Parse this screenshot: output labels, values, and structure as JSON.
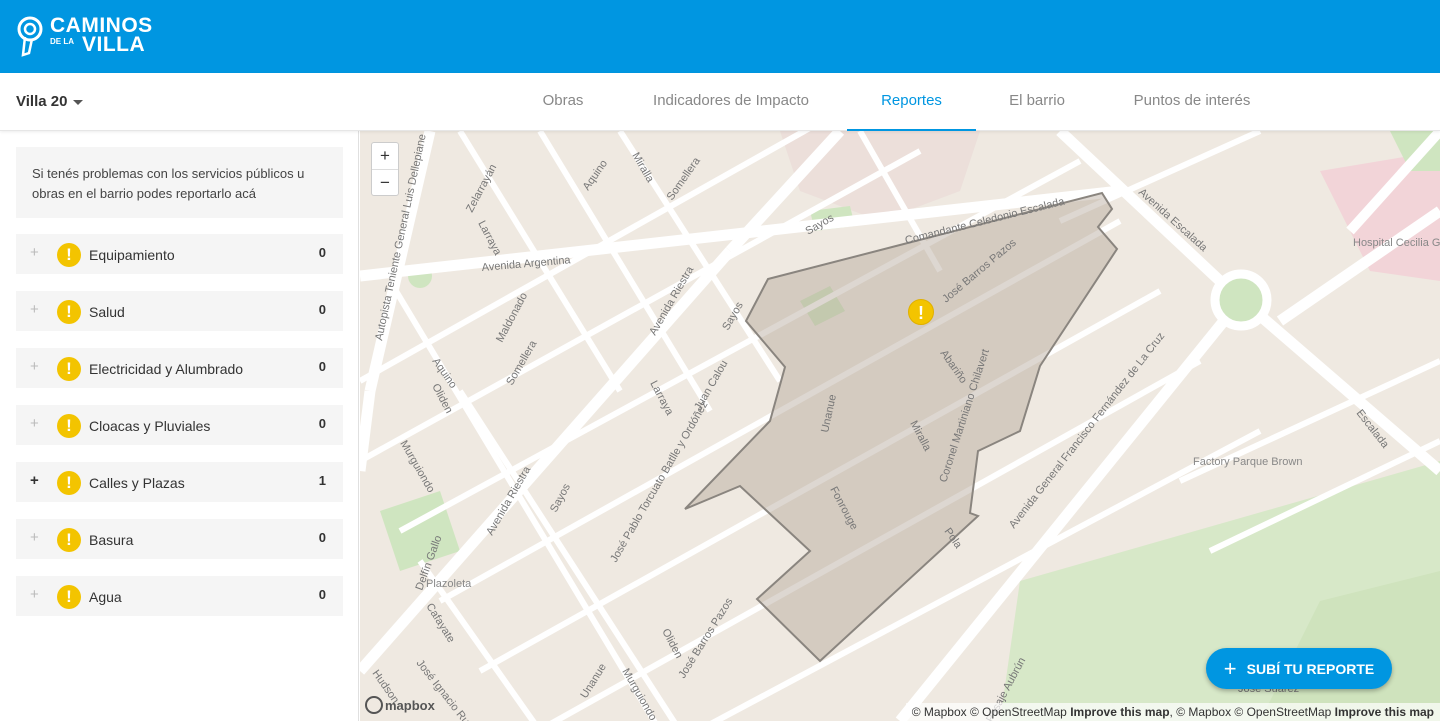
{
  "header": {
    "logo_line1": "CAMINOS",
    "logo_line2": "DE LA",
    "logo_line3": "VILLA",
    "bg_color": "#0096e1"
  },
  "villa_selector": {
    "label": "Villa 20"
  },
  "tabs": [
    {
      "label": "Obras",
      "active": false
    },
    {
      "label": "Indicadores de Impacto",
      "active": false
    },
    {
      "label": "Reportes",
      "active": true
    },
    {
      "label": "El barrio",
      "active": false
    },
    {
      "label": "Puntos de interés",
      "active": false
    }
  ],
  "sidebar": {
    "intro": "Si tenés problemas con los servicios públicos u obras en el barrio podes reportarlo acá",
    "categories": [
      {
        "name": "Equipamiento",
        "count": "0",
        "expand": "+"
      },
      {
        "name": "Salud",
        "count": "0",
        "expand": "+"
      },
      {
        "name": "Electricidad y Alumbrado",
        "count": "0",
        "expand": "+"
      },
      {
        "name": "Cloacas y Pluviales",
        "count": "0",
        "expand": "+"
      },
      {
        "name": "Calles y Plazas",
        "count": "1",
        "expand": "+"
      },
      {
        "name": "Basura",
        "count": "0",
        "expand": "+"
      },
      {
        "name": "Agua",
        "count": "0",
        "expand": "+"
      }
    ],
    "warning_glyph": "!"
  },
  "map": {
    "zoom_in": "+",
    "zoom_out": "−",
    "pin_glyph": "!",
    "mapbox_logo": "mapbox",
    "attribution_parts": [
      "© Mapbox © OpenStreetMap ",
      "Improve this map",
      ", © Mapbox © OpenStreetMap ",
      "Improve this map"
    ],
    "fab_plus": "+",
    "fab_label": "SUBÍ TU REPORTE",
    "street_labels": {
      "autopista": "Autopista Teniente General Luis Dellepiane",
      "zelarrayan": "Zelarrayán",
      "larraya": "Larraya",
      "aquino": "Aquino",
      "miralla": "Miralla",
      "somellera": "Somellera",
      "sayos": "Sayos",
      "celedonio": "Comandante Celedonio Escalada",
      "av_argentina": "Avenida Argentina",
      "maldonado": "Maldonado",
      "av_riestra": "Avenida Riestra",
      "oliden": "Oliden",
      "murguiondo": "Murguiondo",
      "juan_calou": "Juan Calou",
      "batlle": "José Pablo Torcuato Batlle y Ordóñez",
      "delfin_gallo": "Delfín Gallo",
      "plazoleta": "Plazoleta",
      "cafayate": "Cafayate",
      "jose_barros": "José Barros Pazos",
      "abarino": "Abariño",
      "unanue": "Unanue",
      "chilavert": "Coronel Martiniano Chilavert",
      "fonrouge": "Fonrouge",
      "pola": "Pola",
      "av_escalada": "Avenida Escalada",
      "escalada": "Escalada",
      "av_fernandez": "Avenida General Francisco Fernández de La Cruz",
      "hospital": "Hospital Cecilia Grierson",
      "factory": "Factory Parque Brown",
      "hudson": "Hudson",
      "jose_ignacio": "José Ignacio Rucci",
      "aubrun": "Pasaje Aubrún",
      "jose_suarez": "José Suárez"
    }
  }
}
